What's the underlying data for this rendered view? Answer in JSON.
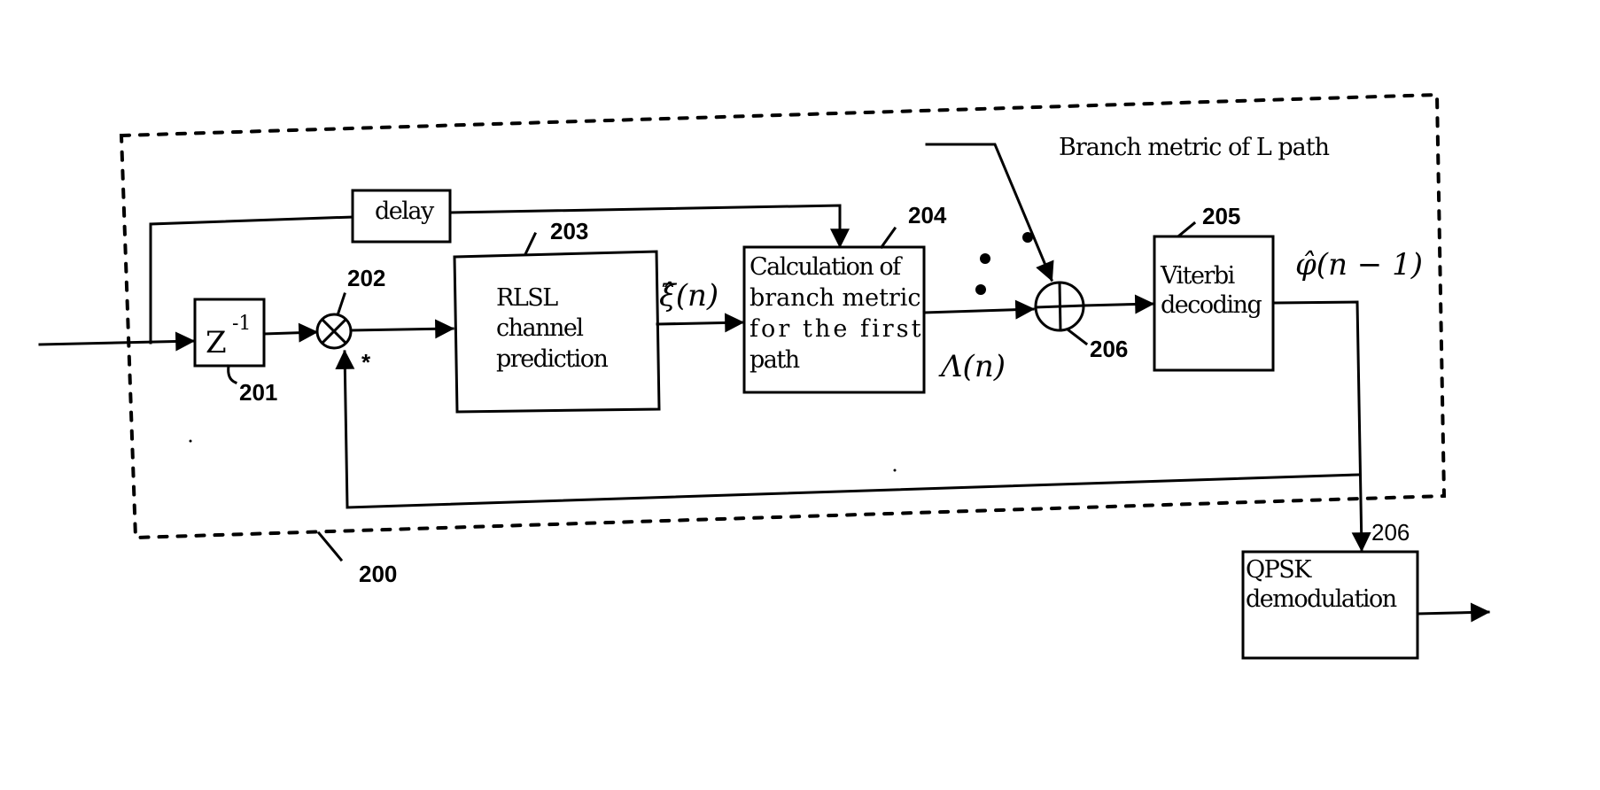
{
  "figure": {
    "type": "block-diagram",
    "ink_color": "#000000",
    "background_color": "#ffffff",
    "enclosure": {
      "ref": "200"
    },
    "blocks": {
      "delay_unit": {
        "label": "Z",
        "superscript": "-1",
        "ref": "201"
      },
      "multiplier": {
        "symbol": "⊗",
        "ref": "202",
        "conjugate_mark": "*"
      },
      "rlsl": {
        "lines": [
          "RLSL",
          "channel",
          "prediction"
        ],
        "ref": "203"
      },
      "branch_calc": {
        "lines": [
          "Calculation of",
          "branch metric",
          "for the first",
          "path"
        ],
        "ref": "204"
      },
      "adder": {
        "symbol": "⊕",
        "ref": "206"
      },
      "viterbi": {
        "lines": [
          "Viterbi",
          "decoding"
        ],
        "ref": "205"
      },
      "qpsk": {
        "lines": [
          "QPSK",
          "demodulation"
        ],
        "ref": "206"
      },
      "delay_box": {
        "label": "delay"
      }
    },
    "signals": {
      "xi_hat": "ξ̂(n)",
      "lambda": "Λ(n)",
      "phi_hat": "φ̂(n − 1)",
      "branch_metric_L": "Branch metric of L path"
    },
    "ellipsis_dots": 3
  }
}
